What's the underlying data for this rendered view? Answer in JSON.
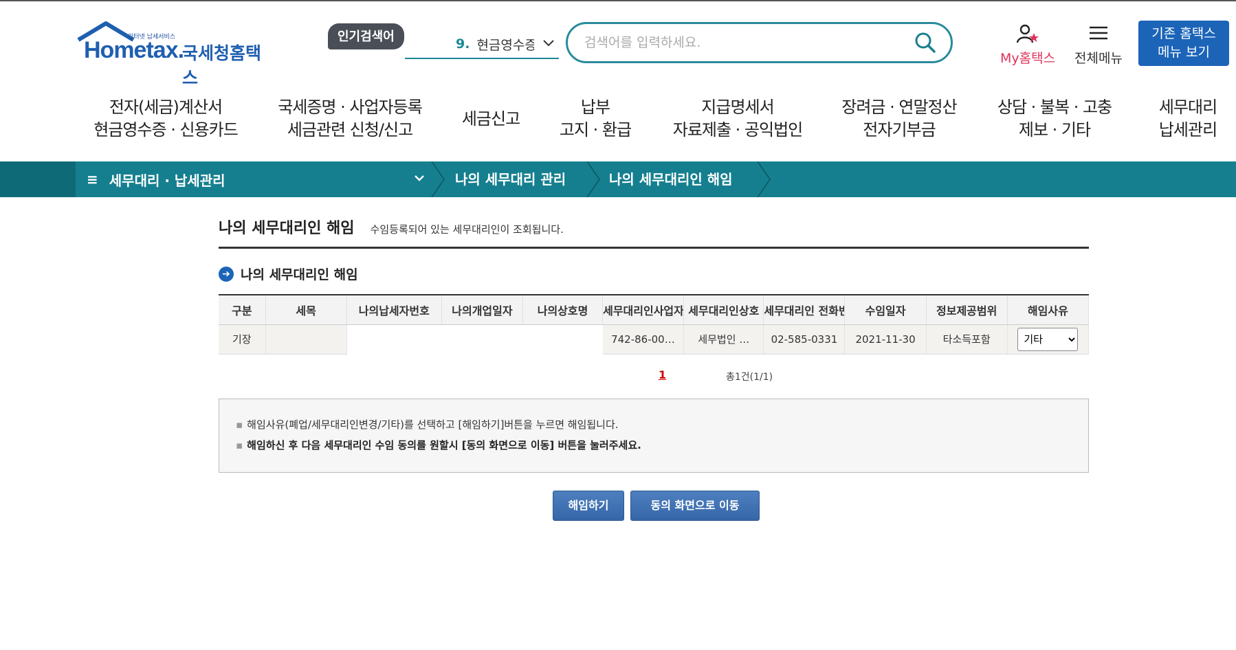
{
  "header": {
    "logo_tagline": "인터넷 납세서비스",
    "logo_word": "Hometax.",
    "logo_name": "국세청홈택스",
    "popular_badge": "인기검색어",
    "popular_rank": "9.",
    "popular_term": "현금영수증",
    "search_placeholder": "검색어를 입력하세요.",
    "my_hometax": "My홈택스",
    "all_menu": "전체메뉴",
    "old_hometax_line1": "기존 홈택스",
    "old_hometax_line2": "메뉴 보기"
  },
  "gnb": [
    {
      "line1": "전자(세금)계산서",
      "line2": "현금영수증 · 신용카드"
    },
    {
      "line1": "국세증명 · 사업자등록",
      "line2": "세금관련 신청/신고"
    },
    {
      "line1": "세금신고",
      "line2": ""
    },
    {
      "line1": "납부",
      "line2": "고지 · 환급"
    },
    {
      "line1": "지급명세서",
      "line2": "자료제출 · 공익법인"
    },
    {
      "line1": "장려금 · 연말정산",
      "line2": "전자기부금"
    },
    {
      "line1": "상담 · 불복 · 고충",
      "line2": "제보 · 기타"
    },
    {
      "line1": "세무대리",
      "line2": "납세관리"
    }
  ],
  "location": {
    "menu_icon": "≡",
    "level1": "세무대리 · 납세관리",
    "level2": "나의 세무대리 관리",
    "level3": "나의 세무대리인 해임"
  },
  "page": {
    "title": "나의 세무대리인 해임",
    "description": "수임등록되어 있는 세무대리인이 조회됩니다.",
    "section_title": "나의 세무대리인 해임"
  },
  "table": {
    "headers": [
      "구분",
      "세목",
      "나의납세자번호",
      "나의개업일자",
      "나의상호명",
      "세무대리인사업자번호",
      "세무대리인상호",
      "세무대리인 전화번호",
      "수임일자",
      "정보제공범위",
      "해임사유"
    ],
    "rows": [
      {
        "type": "기장",
        "tax_item": "",
        "my_taxpayer_no": "",
        "my_open_date": "",
        "my_company": "",
        "agent_biz_no": "742-86-00…",
        "agent_name": "세무법인 …",
        "agent_phone": "02-585-0331",
        "contract_date": "2021-11-30",
        "info_scope": "타소득포함",
        "reason_selected": "기타"
      }
    ]
  },
  "pagination": {
    "current_page": "1",
    "total_text": "총1건(1/1)"
  },
  "notice": {
    "line1": "해임사유(폐업/세무대리인변경/기타)를 선택하고 [해임하기]버튼을 누르면 해임됩니다.",
    "line2": "해임하신 후 다음 세무대리인 수임 동의를 원할시 [동의 화면으로 이동] 버튼을 눌러주세요."
  },
  "buttons": {
    "dismiss": "해임하기",
    "go_consent": "동의 화면으로 이동"
  },
  "colors": {
    "brand_blue": "#1b64b8",
    "teal": "#157f8f",
    "my_pink": "#e0325a"
  }
}
